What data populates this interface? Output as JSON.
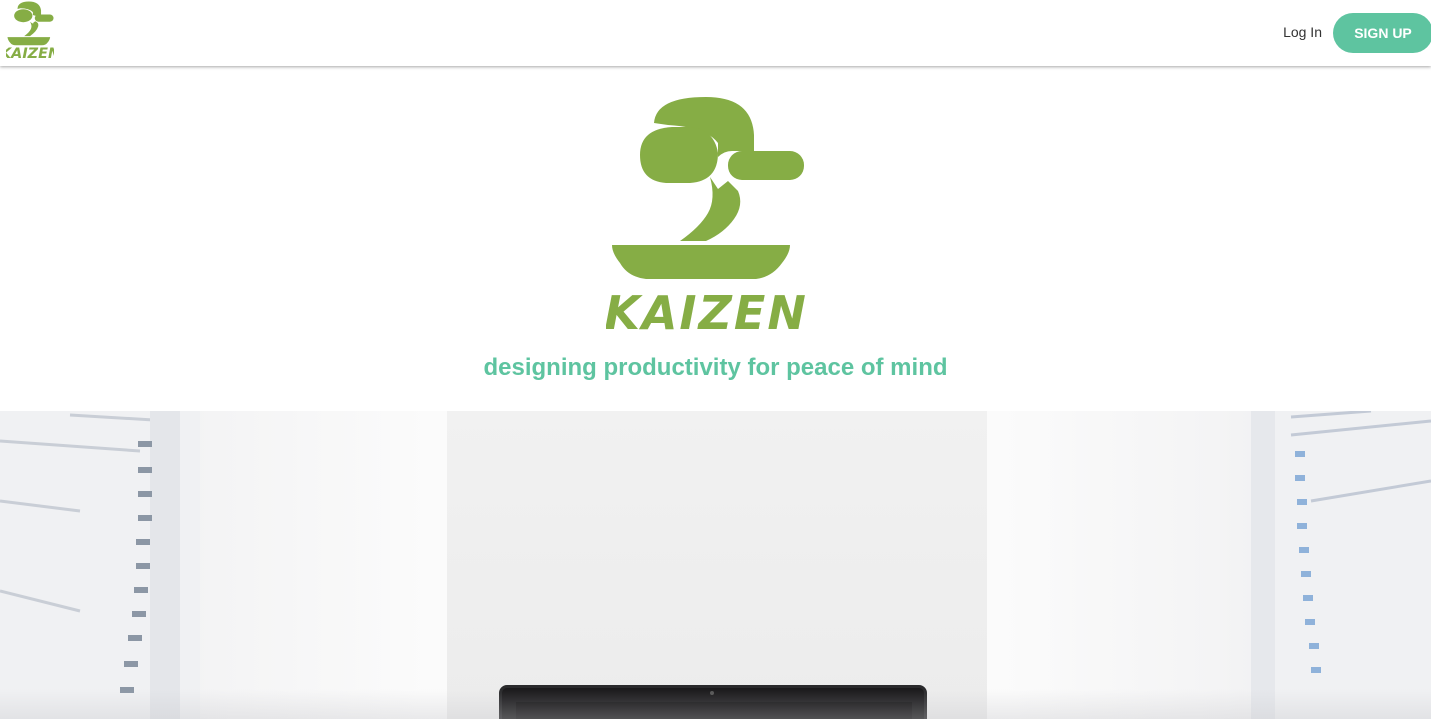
{
  "nav": {
    "logo_text": "KAIZEN",
    "login_label": "Log In",
    "signup_label": "SIGN UP"
  },
  "hero": {
    "logo_text": "KAIZEN",
    "tagline": "designing productivity for peace of mind"
  },
  "colors": {
    "brand_green": "#86ad45",
    "accent_teal": "#5ec4a0"
  },
  "icons": {
    "logo": "bonsai-tree-logo"
  }
}
